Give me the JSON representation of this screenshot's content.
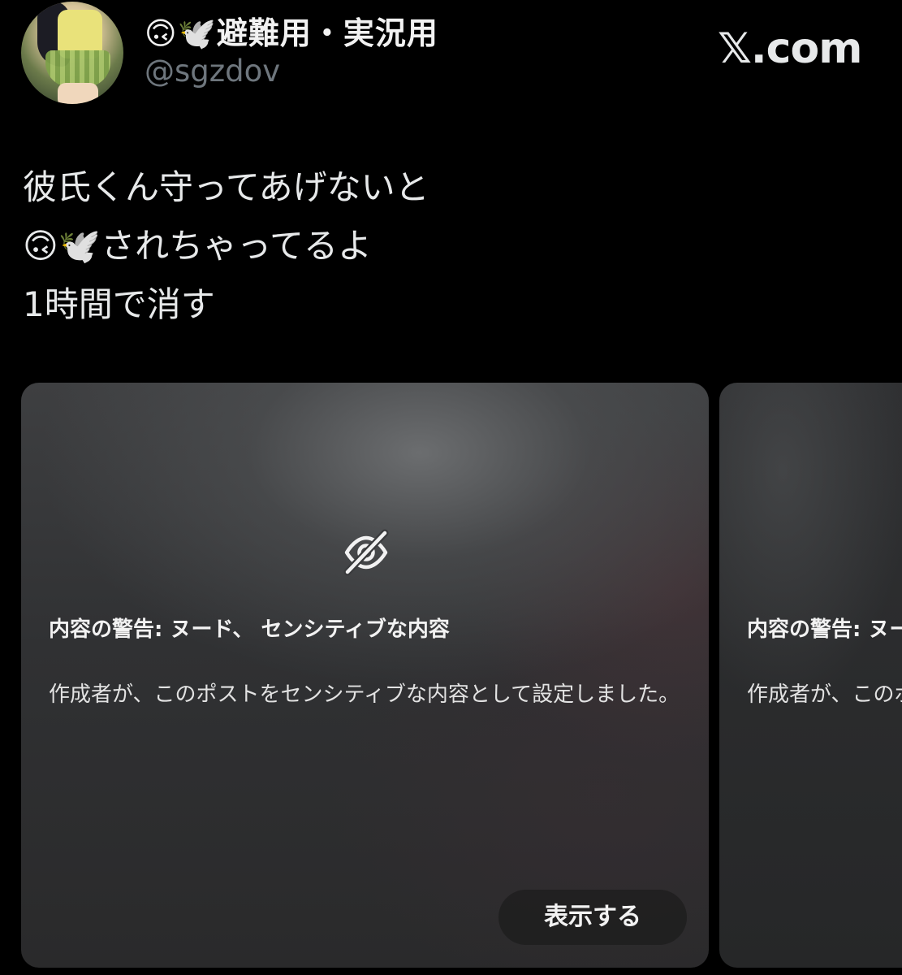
{
  "profile": {
    "display_name": "🙃🕊️避難用・実況用",
    "handle": "@sgzdov"
  },
  "brand": {
    "label": "𝕏.com"
  },
  "post": {
    "lines": [
      "彼氏くん守ってあげないと",
      "🙃🕊️されちゃってるよ",
      "1時間で消す"
    ]
  },
  "media": [
    {
      "warning_title": "内容の警告: ヌード、 センシティブな内容",
      "warning_desc": "作成者が、このポストをセンシティブな内容として設定しました。",
      "show_label": "表示する"
    },
    {
      "warning_title": "内容の警告: ヌード、 センシティブな内容",
      "warning_desc": "作成者が、このポストをセンシティブな内容として設定しました。"
    }
  ],
  "icons": {
    "hidden": "eye-off-icon"
  }
}
